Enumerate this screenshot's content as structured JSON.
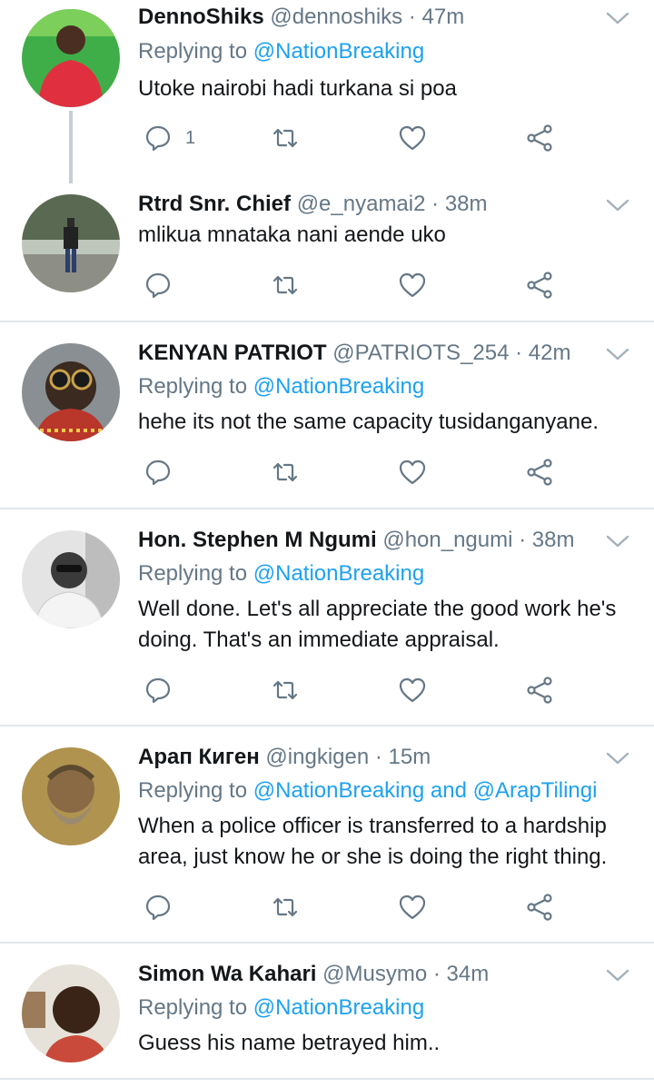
{
  "tweets": [
    {
      "name": "DennoShiks",
      "handle": "@dennoshiks",
      "separator": "·",
      "time": "47m",
      "replying_prefix": "Replying to",
      "replying_to": "@NationBreaking",
      "replying_join": "",
      "replying_to_2": "",
      "text": "Utoke nairobi hadi turkana si poa",
      "reply_count": "1",
      "avatar_bg": "#3fae49",
      "avatar_fg": "#e03040"
    },
    {
      "name": "Rtrd Snr. Chief",
      "handle": "@e_nyamai2",
      "separator": "·",
      "time": "38m",
      "replying_prefix": "",
      "replying_to": "",
      "replying_join": "",
      "replying_to_2": "",
      "text": "mlikua mnataka nani aende uko",
      "reply_count": "",
      "avatar_bg": "#9aa69a",
      "avatar_fg": "#222222"
    },
    {
      "name": "KENYAN PATRIOT",
      "handle": "@PATRIOTS_254",
      "separator": "·",
      "time": "42m",
      "replying_prefix": "Replying to",
      "replying_to": "@NationBreaking",
      "replying_join": "",
      "replying_to_2": "",
      "text": "hehe its not the same capacity tusidanganyane.",
      "reply_count": "",
      "avatar_bg": "#8a8f93",
      "avatar_fg": "#3b2a20"
    },
    {
      "name": "Hon. Stephen M Ngumi",
      "handle": "@hon_ngumi",
      "separator": "·",
      "time": "38m",
      "replying_prefix": "Replying to",
      "replying_to": "@NationBreaking",
      "replying_join": "",
      "replying_to_2": "",
      "text": "Well done. Let's all appreciate the good work he's doing. That's an immediate appraisal.",
      "reply_count": "",
      "avatar_bg": "#d8d8d8",
      "avatar_fg": "#333333"
    },
    {
      "name": "Арап Киген",
      "handle": "@ingkigen",
      "separator": "·",
      "time": "15m",
      "replying_prefix": "Replying to",
      "replying_to": "@NationBreaking",
      "replying_join": "and",
      "replying_to_2": "@ArapTilingi",
      "text": "When a police officer is transferred to a hardship area, just know he or she is doing the right thing.",
      "reply_count": "",
      "avatar_bg": "#a8894a",
      "avatar_fg": "#6b5a3a"
    },
    {
      "name": "Simon Wa Kahari",
      "handle": "@Musymo",
      "separator": "·",
      "time": "34m",
      "replying_prefix": "Replying to",
      "replying_to": "@NationBreaking",
      "replying_join": "",
      "replying_to_2": "",
      "text": "Guess his name betrayed him..",
      "reply_count": "",
      "avatar_bg": "#e6e2da",
      "avatar_fg": "#3a2418"
    }
  ],
  "colors": {
    "text": "#14171a",
    "muted": "#657786",
    "link": "#1da1f2",
    "divider": "#e1e8ed",
    "thread_line": "#c4cfd6"
  },
  "icons": [
    "reply-icon",
    "retweet-icon",
    "like-icon",
    "share-icon",
    "chevron-down-icon"
  ]
}
